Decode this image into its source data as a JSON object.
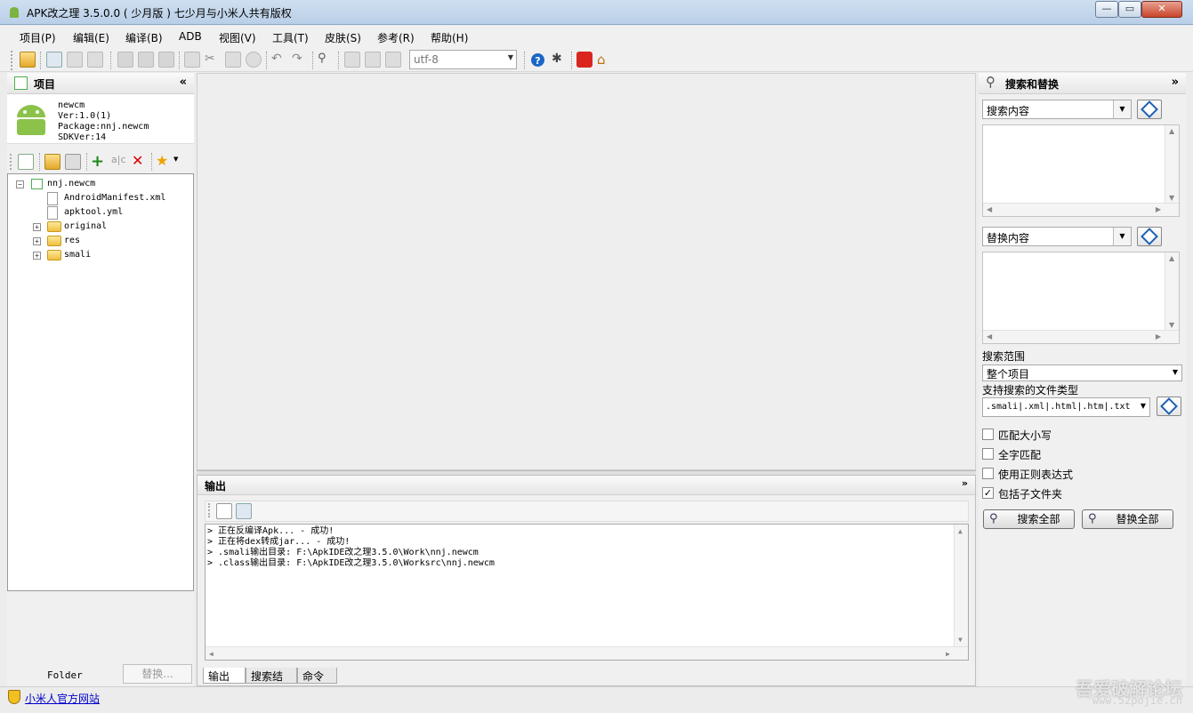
{
  "window": {
    "title": "APK改之理 3.5.0.0 ( 少月版 )  七少月与小米人共有版权",
    "min": "—",
    "max": "▭",
    "close": "✕"
  },
  "menu": [
    "项目(P)",
    "编辑(E)",
    "编译(B)",
    "ADB",
    "视图(V)",
    "工具(T)",
    "皮肤(S)",
    "参考(R)",
    "帮助(H)"
  ],
  "toolbar": {
    "encoding": "utf-8"
  },
  "project": {
    "title": "项目",
    "collapse": "«",
    "apk_name": "newcm",
    "version": "Ver:1.0(1)",
    "package": "Package:nnj.newcm",
    "sdk": "SDKVer:14",
    "tree_root": "nnj.newcm",
    "tree_items": [
      "AndroidManifest.xml",
      "apktool.yml",
      "original",
      "res",
      "smali"
    ],
    "folder_label": "Folder",
    "replace_button": "替换..."
  },
  "output": {
    "title": "输出",
    "collapse": "»",
    "lines": [
      "> 正在反编译Apk...  - 成功!",
      "> 正在将dex转成jar...  - 成功!",
      "> .smali输出目录: F:\\ApkIDE改之理3.5.0\\Work\\nnj.newcm",
      "> .class输出目录: F:\\ApkIDE改之理3.5.0\\Worksrc\\nnj.newcm"
    ],
    "tabs": [
      "输出",
      "搜索结果",
      "命令"
    ]
  },
  "search": {
    "title": "搜索和替换",
    "collapse": "»",
    "search_combo": "搜索内容",
    "replace_combo": "替换内容",
    "scope_label": "搜索范围",
    "scope_value": "整个项目",
    "filetypes_label": "支持搜索的文件类型",
    "filetypes_value": ".smali|.xml|.html|.htm|.txt",
    "options": [
      {
        "label": "匹配大小写",
        "checked": false
      },
      {
        "label": "全字匹配",
        "checked": false
      },
      {
        "label": "使用正则表达式",
        "checked": false
      },
      {
        "label": "包括子文件夹",
        "checked": true
      }
    ],
    "search_all": "搜索全部",
    "replace_all": "替换全部"
  },
  "status": {
    "link": "小米人官方网站",
    "watermark": "吾爱破解论坛",
    "watermark_url": "www.52pojie.cn"
  }
}
